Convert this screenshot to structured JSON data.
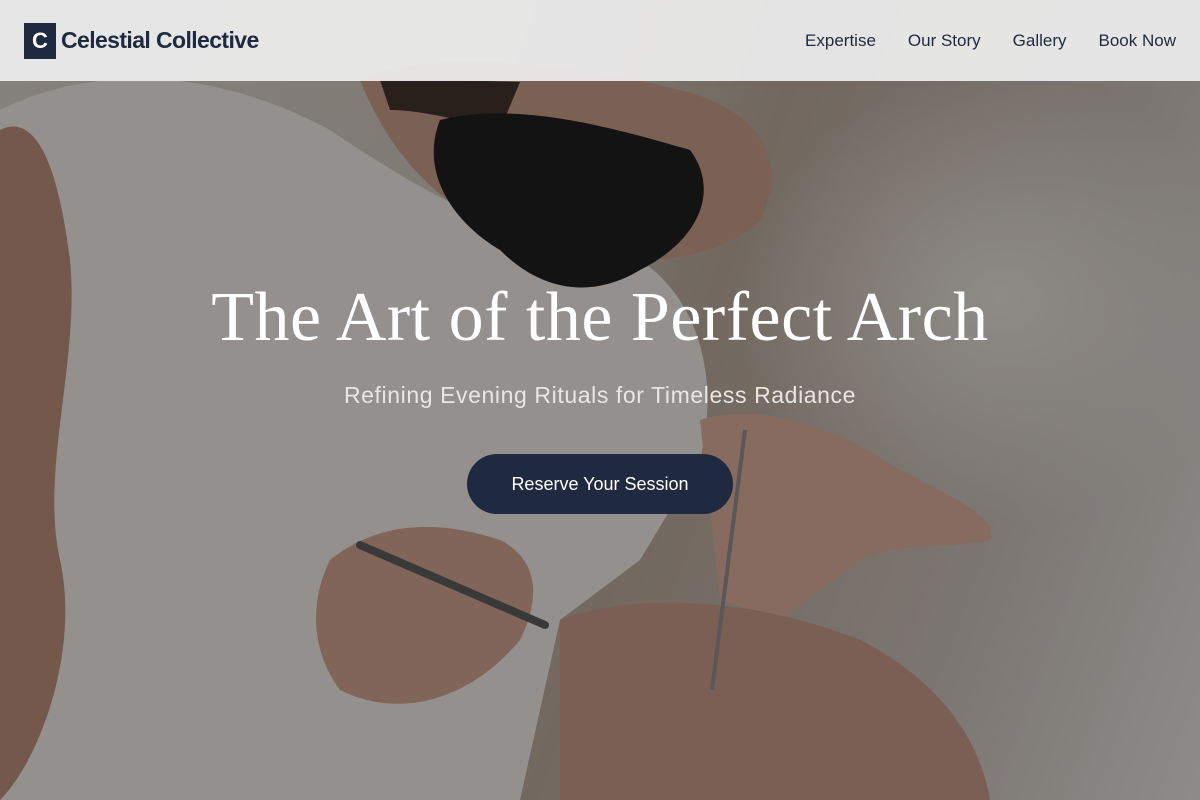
{
  "brand": {
    "mark": "C",
    "name": "Celestial Collective"
  },
  "nav": {
    "items": [
      {
        "label": "Expertise"
      },
      {
        "label": "Our Story"
      },
      {
        "label": "Gallery"
      },
      {
        "label": "Book Now"
      }
    ]
  },
  "hero": {
    "title": "The Art of the Perfect Arch",
    "subtitle": "Refining Evening Rituals for Timeless Radiance",
    "cta_label": "Reserve Your Session",
    "image_description_icon": "lash-technician-photo"
  },
  "colors": {
    "brand": "#1f2a40",
    "header_bg": "#eeeeee",
    "hero_text": "#ffffff"
  }
}
